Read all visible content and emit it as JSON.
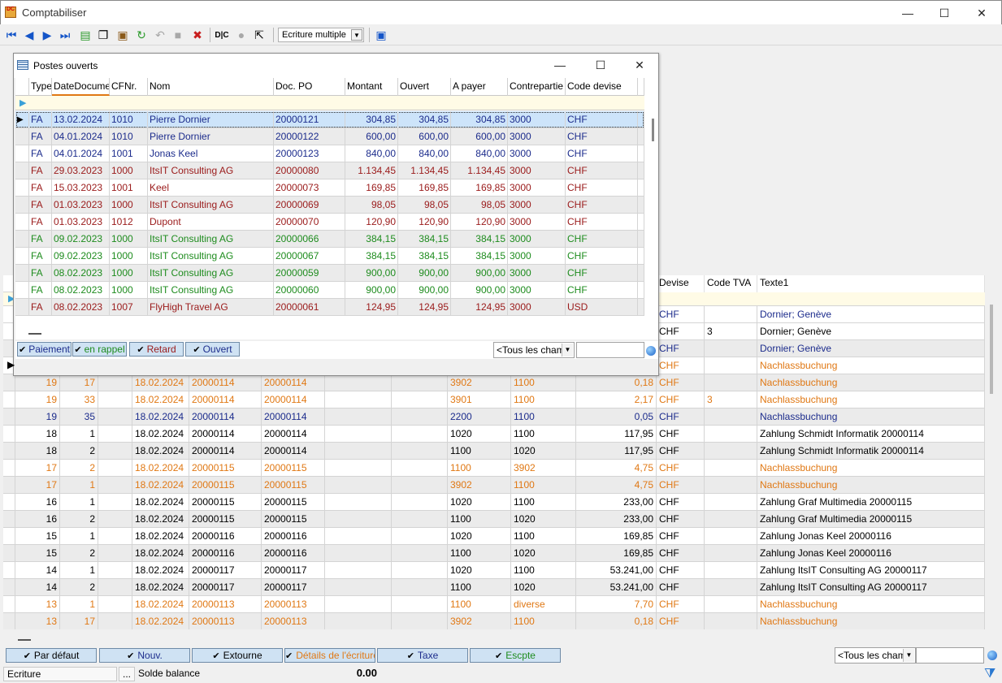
{
  "window": {
    "title": "Comptabiliser",
    "min": "—",
    "max": "☐",
    "close": "✕"
  },
  "toolbar": {
    "mode_combo": "Ecriture multiple"
  },
  "main_grid": {
    "headers": {
      "devise": "Devise",
      "code_tva": "Code TVA",
      "texte1": "Texte1"
    },
    "rows": [
      {
        "color": "navy",
        "alt": false,
        "devise": "CHF",
        "tva": "",
        "texte": "Dornier; Genève",
        "c": [
          "",
          "",
          "",
          "",
          "",
          "",
          "",
          "",
          ""
        ]
      },
      {
        "color": "black",
        "alt": false,
        "devise": "CHF",
        "tva": "3",
        "texte": "Dornier; Genève",
        "c": [
          "",
          "",
          "",
          "",
          "",
          "",
          "",
          "",
          ""
        ]
      },
      {
        "color": "navy",
        "alt": true,
        "devise": "CHF",
        "tva": "",
        "texte": "Dornier; Genève",
        "c": [
          "",
          "",
          "",
          "",
          "",
          "",
          "",
          "",
          ""
        ]
      },
      {
        "color": "orange",
        "alt": false,
        "devise": "CHF",
        "tva": "",
        "texte": "Nachlassbuchung",
        "c": [
          "",
          "",
          "",
          "",
          "",
          "",
          "",
          "",
          ""
        ]
      },
      {
        "color": "orange",
        "alt": true,
        "devise": "CHF",
        "tva": "",
        "texte": "Nachlassbuchung",
        "c": [
          "19",
          "17",
          "18.02.2024",
          "20000114",
          "20000114",
          "",
          "3902",
          "1100",
          "0,18"
        ]
      },
      {
        "color": "orange",
        "alt": false,
        "devise": "CHF",
        "tva": "3",
        "texte": "Nachlassbuchung",
        "c": [
          "19",
          "33",
          "18.02.2024",
          "20000114",
          "20000114",
          "",
          "3901",
          "1100",
          "2,17"
        ]
      },
      {
        "color": "navy",
        "alt": true,
        "devise": "CHF",
        "tva": "",
        "texte": "Nachlassbuchung",
        "c": [
          "19",
          "35",
          "18.02.2024",
          "20000114",
          "20000114",
          "",
          "2200",
          "1100",
          "0,05"
        ]
      },
      {
        "color": "black",
        "alt": false,
        "devise": "CHF",
        "tva": "",
        "texte": "Zahlung Schmidt Informatik 20000114",
        "c": [
          "18",
          "1",
          "18.02.2024",
          "20000114",
          "20000114",
          "",
          "1020",
          "1100",
          "117,95"
        ]
      },
      {
        "color": "black",
        "alt": true,
        "devise": "CHF",
        "tva": "",
        "texte": "Zahlung Schmidt Informatik 20000114",
        "c": [
          "18",
          "2",
          "18.02.2024",
          "20000114",
          "20000114",
          "",
          "1100",
          "1020",
          "117,95"
        ]
      },
      {
        "color": "orange",
        "alt": false,
        "devise": "CHF",
        "tva": "",
        "texte": "Nachlassbuchung",
        "c": [
          "17",
          "2",
          "18.02.2024",
          "20000115",
          "20000115",
          "",
          "1100",
          "3902",
          "4,75"
        ]
      },
      {
        "color": "orange",
        "alt": true,
        "devise": "CHF",
        "tva": "",
        "texte": "Nachlassbuchung",
        "c": [
          "17",
          "1",
          "18.02.2024",
          "20000115",
          "20000115",
          "",
          "3902",
          "1100",
          "4,75"
        ]
      },
      {
        "color": "black",
        "alt": false,
        "devise": "CHF",
        "tva": "",
        "texte": "Zahlung Graf Multimedia 20000115",
        "c": [
          "16",
          "1",
          "18.02.2024",
          "20000115",
          "20000115",
          "",
          "1020",
          "1100",
          "233,00"
        ]
      },
      {
        "color": "black",
        "alt": true,
        "devise": "CHF",
        "tva": "",
        "texte": "Zahlung Graf Multimedia 20000115",
        "c": [
          "16",
          "2",
          "18.02.2024",
          "20000115",
          "20000115",
          "",
          "1100",
          "1020",
          "233,00"
        ]
      },
      {
        "color": "black",
        "alt": false,
        "devise": "CHF",
        "tva": "",
        "texte": "Zahlung Jonas Keel 20000116",
        "c": [
          "15",
          "1",
          "18.02.2024",
          "20000116",
          "20000116",
          "",
          "1020",
          "1100",
          "169,85"
        ]
      },
      {
        "color": "black",
        "alt": true,
        "devise": "CHF",
        "tva": "",
        "texte": "Zahlung Jonas Keel 20000116",
        "c": [
          "15",
          "2",
          "18.02.2024",
          "20000116",
          "20000116",
          "",
          "1100",
          "1020",
          "169,85"
        ]
      },
      {
        "color": "black",
        "alt": false,
        "devise": "CHF",
        "tva": "",
        "texte": "Zahlung ItsIT Consulting AG 20000117",
        "c": [
          "14",
          "1",
          "18.02.2024",
          "20000117",
          "20000117",
          "",
          "1020",
          "1100",
          "53.241,00"
        ]
      },
      {
        "color": "black",
        "alt": true,
        "devise": "CHF",
        "tva": "",
        "texte": "Zahlung ItsIT Consulting AG 20000117",
        "c": [
          "14",
          "2",
          "18.02.2024",
          "20000117",
          "20000117",
          "",
          "1100",
          "1020",
          "53.241,00"
        ]
      },
      {
        "color": "orange",
        "alt": false,
        "devise": "CHF",
        "tva": "",
        "texte": "Nachlassbuchung",
        "c": [
          "13",
          "1",
          "18.02.2024",
          "20000113",
          "20000113",
          "",
          "1100",
          "diverse",
          "7,70"
        ]
      },
      {
        "color": "orange",
        "alt": true,
        "devise": "CHF",
        "tva": "",
        "texte": "Nachlassbuchung",
        "c": [
          "13",
          "17",
          "18.02.2024",
          "20000113",
          "20000113",
          "",
          "3902",
          "1100",
          "0,18"
        ]
      }
    ]
  },
  "bottom_filters": {
    "buttons": [
      "Par défaut",
      "Nouv.",
      "Extourne",
      "Détails de l'écriture",
      "Taxe",
      "Escpte"
    ],
    "colors": [
      "#000000",
      "#1c2c8c",
      "#000000",
      "#e07814",
      "#1c2c8c",
      "#1e8c1e"
    ],
    "field_combo": "<Tous les champ",
    "check": "✔"
  },
  "statusbar": {
    "mode": "Ecriture",
    "dots": "...",
    "label": "Solde balance",
    "value": "0.00"
  },
  "popup": {
    "title": "Postes ouverts",
    "min": "—",
    "max": "☐",
    "close": "✕",
    "headers": [
      "Type",
      "DateDocumen",
      "CFNr.",
      "Nom",
      "Doc. PO",
      "Montant",
      "Ouvert",
      "A payer",
      "Contrepartie",
      "Code devise"
    ],
    "rows": [
      {
        "color": "navy",
        "sel": true,
        "c": [
          "FA",
          "13.02.2024",
          "1010",
          "Pierre Dornier",
          "20000121",
          "304,85",
          "304,85",
          "304,85",
          "3000",
          "CHF"
        ]
      },
      {
        "color": "navy",
        "c": [
          "FA",
          "04.01.2024",
          "1010",
          "Pierre Dornier",
          "20000122",
          "600,00",
          "600,00",
          "600,00",
          "3000",
          "CHF"
        ]
      },
      {
        "color": "navy",
        "c": [
          "FA",
          "04.01.2024",
          "1001",
          "Jonas Keel",
          "20000123",
          "840,00",
          "840,00",
          "840,00",
          "3000",
          "CHF"
        ]
      },
      {
        "color": "red",
        "c": [
          "FA",
          "29.03.2023",
          "1000",
          "ItsIT Consulting AG",
          "20000080",
          "1.134,45",
          "1.134,45",
          "1.134,45",
          "3000",
          "CHF"
        ]
      },
      {
        "color": "red",
        "c": [
          "FA",
          "15.03.2023",
          "1001",
          "Keel",
          "20000073",
          "169,85",
          "169,85",
          "169,85",
          "3000",
          "CHF"
        ]
      },
      {
        "color": "red",
        "c": [
          "FA",
          "01.03.2023",
          "1000",
          "ItsIT Consulting AG",
          "20000069",
          "98,05",
          "98,05",
          "98,05",
          "3000",
          "CHF"
        ]
      },
      {
        "color": "red",
        "c": [
          "FA",
          "01.03.2023",
          "1012",
          "Dupont",
          "20000070",
          "120,90",
          "120,90",
          "120,90",
          "3000",
          "CHF"
        ]
      },
      {
        "color": "green",
        "c": [
          "FA",
          "09.02.2023",
          "1000",
          "ItsIT Consulting AG",
          "20000066",
          "384,15",
          "384,15",
          "384,15",
          "3000",
          "CHF"
        ]
      },
      {
        "color": "green",
        "c": [
          "FA",
          "09.02.2023",
          "1000",
          "ItsIT Consulting AG",
          "20000067",
          "384,15",
          "384,15",
          "384,15",
          "3000",
          "CHF"
        ]
      },
      {
        "color": "green",
        "c": [
          "FA",
          "08.02.2023",
          "1000",
          "ItsIT Consulting AG",
          "20000059",
          "900,00",
          "900,00",
          "900,00",
          "3000",
          "CHF"
        ]
      },
      {
        "color": "green",
        "c": [
          "FA",
          "08.02.2023",
          "1000",
          "ItsIT Consulting AG",
          "20000060",
          "900,00",
          "900,00",
          "900,00",
          "3000",
          "CHF"
        ]
      },
      {
        "color": "red",
        "c": [
          "FA",
          "08.02.2023",
          "1007",
          "FlyHigh Travel AG",
          "20000061",
          "124,95",
          "124,95",
          "124,95",
          "3000",
          "USD"
        ]
      }
    ],
    "filters": [
      "Paiement",
      "en rappel",
      "Retard",
      "Ouvert"
    ],
    "filter_colors": [
      "#1c2c8c",
      "#1e8c1e",
      "#9a1a1a",
      "#1c2c8c"
    ],
    "field_combo": "<Tous les champ"
  }
}
